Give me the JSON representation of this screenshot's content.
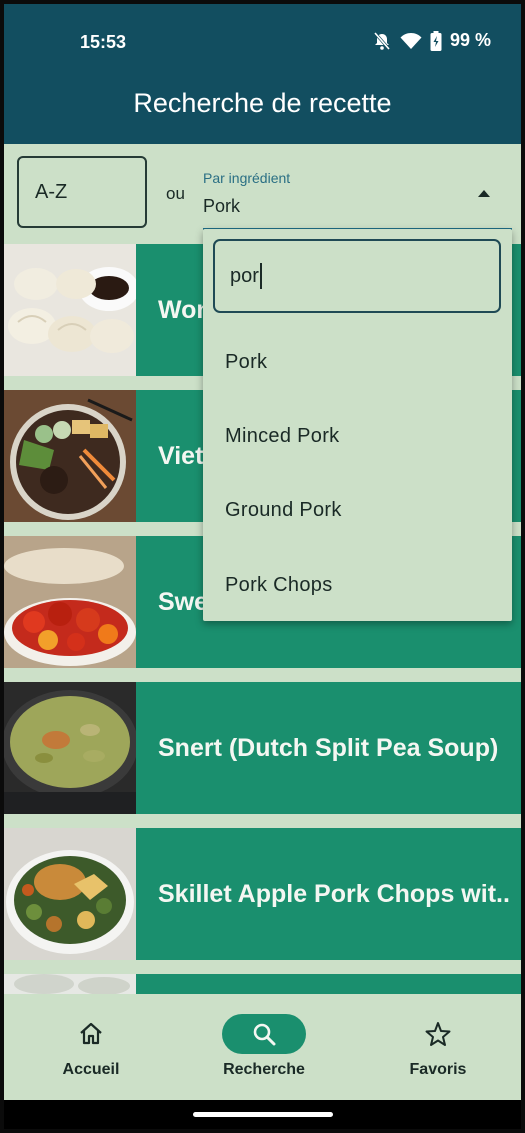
{
  "status_bar": {
    "time": "15:53",
    "battery": "99 %"
  },
  "app_bar": {
    "title": "Recherche de recette"
  },
  "filters": {
    "az_value": "A-Z",
    "or_label": "ou",
    "ingredient_caption": "Par ingrédient",
    "ingredient_value": "Pork"
  },
  "dropdown": {
    "search_text": "por",
    "options": [
      "Pork",
      "Minced Pork",
      "Ground Pork",
      "Pork Chops"
    ]
  },
  "recipes": [
    {
      "title": "Won"
    },
    {
      "title": "Viet"
    },
    {
      "title": "Swe"
    },
    {
      "title": "Snert (Dutch Split Pea Soup)"
    },
    {
      "title": "Skillet Apple Pork Chops wit..."
    }
  ],
  "bottom_nav": {
    "items": [
      {
        "label": "Accueil",
        "icon": "home-icon"
      },
      {
        "label": "Recherche",
        "icon": "search-icon"
      },
      {
        "label": "Favoris",
        "icon": "star-icon"
      }
    ],
    "active": "Recherche"
  },
  "colors": {
    "app_bar": "#124e60",
    "background": "#cce0c8",
    "recipe_row": "#1a8f6e",
    "accent": "#1e6d85"
  }
}
